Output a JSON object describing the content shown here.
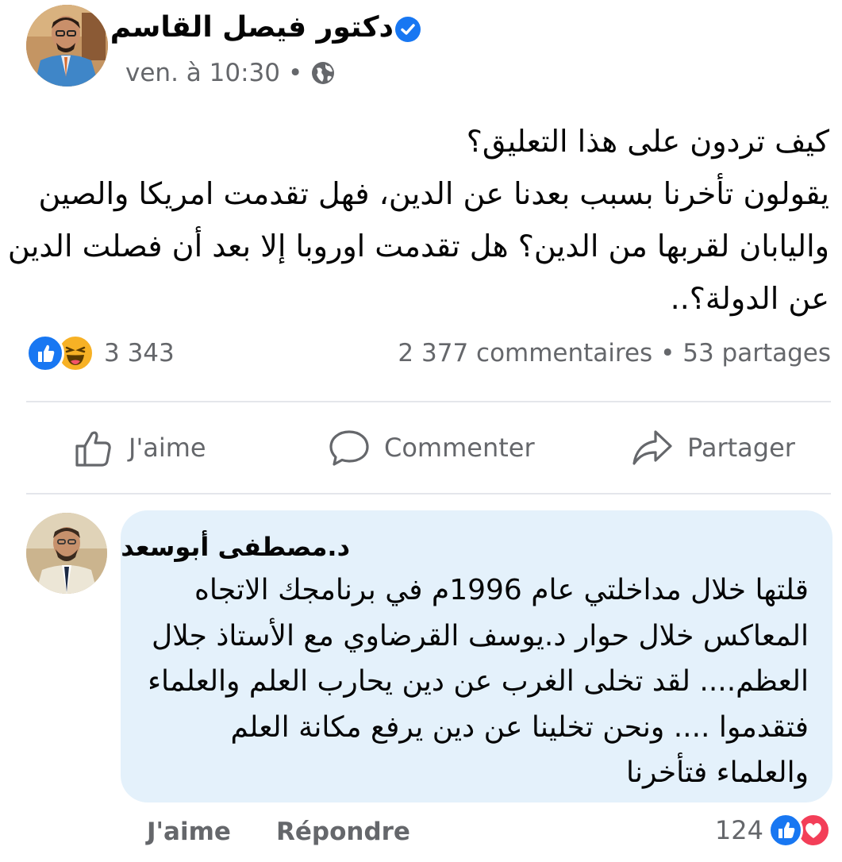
{
  "post": {
    "author": "دكتور فيصل القاسم",
    "time": "ven. à 10:30",
    "separator": "•",
    "text_lines": [
      "كيف تردون على هذا التعليق؟",
      "يقولون تأخرنا بسبب بعدنا عن الدين، فهل تقدمت امريكا والصين",
      "واليابان لقربها من الدين؟ هل تقدمت اوروبا إلا بعد أن فصلت الدين",
      "عن الدولة؟.."
    ],
    "reaction_count": "3 343",
    "comments": "2 377 commentaires",
    "stats_separator": "•",
    "shares": "53 partages",
    "reaction_icons": [
      "like-icon",
      "haha-icon"
    ]
  },
  "actions": {
    "like": "J'aime",
    "comment": "Commenter",
    "share": "Partager"
  },
  "comment": {
    "author": "د.مصطفى أبوسعد",
    "text_lines": [
      "قلتها خلال مداخلتي عام 1996م في برنامجك الاتجاه",
      "المعاكس خلال حوار د.يوسف القرضاوي مع الأستاذ جلال",
      "العظم.... لقد تخلى الغرب عن دين يحارب العلم والعلماء",
      "فتقدموا .... ونحن تخلينا عن دين يرفع مكانة العلم",
      "والعلماء فتأخرنا"
    ],
    "like_label": "J'aime",
    "reply_label": "Répondre",
    "reaction_count": "124",
    "reaction_icons": [
      "like-icon",
      "love-icon"
    ]
  },
  "colors": {
    "facebook_blue": "#1877f2",
    "secondary_text": "#65676b",
    "comment_bubble": "#e4f1fb",
    "love_red": "#f33e58",
    "haha_yellow": "#f7b125"
  }
}
